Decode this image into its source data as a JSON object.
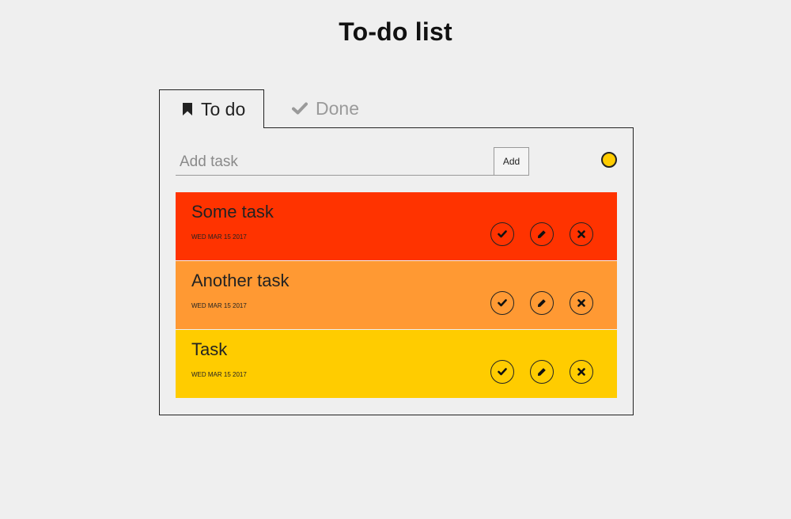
{
  "header": {
    "title": "To-do list"
  },
  "tabs": [
    {
      "label": "To do",
      "icon": "bookmark-icon",
      "active": true
    },
    {
      "label": "Done",
      "icon": "check-icon",
      "active": false
    }
  ],
  "add_task": {
    "placeholder": "Add task",
    "value": "",
    "button_label": "Add",
    "selected_color": "#ffcc00"
  },
  "tasks": [
    {
      "name": "Some task",
      "date": "WED MAR 15 2017",
      "color": "#ff3300"
    },
    {
      "name": "Another task",
      "date": "WED MAR 15 2017",
      "color": "#ff9933"
    },
    {
      "name": "Task",
      "date": "WED MAR 15 2017",
      "color": "#ffcc00"
    }
  ],
  "task_actions": [
    "complete-icon",
    "edit-icon",
    "delete-icon"
  ]
}
